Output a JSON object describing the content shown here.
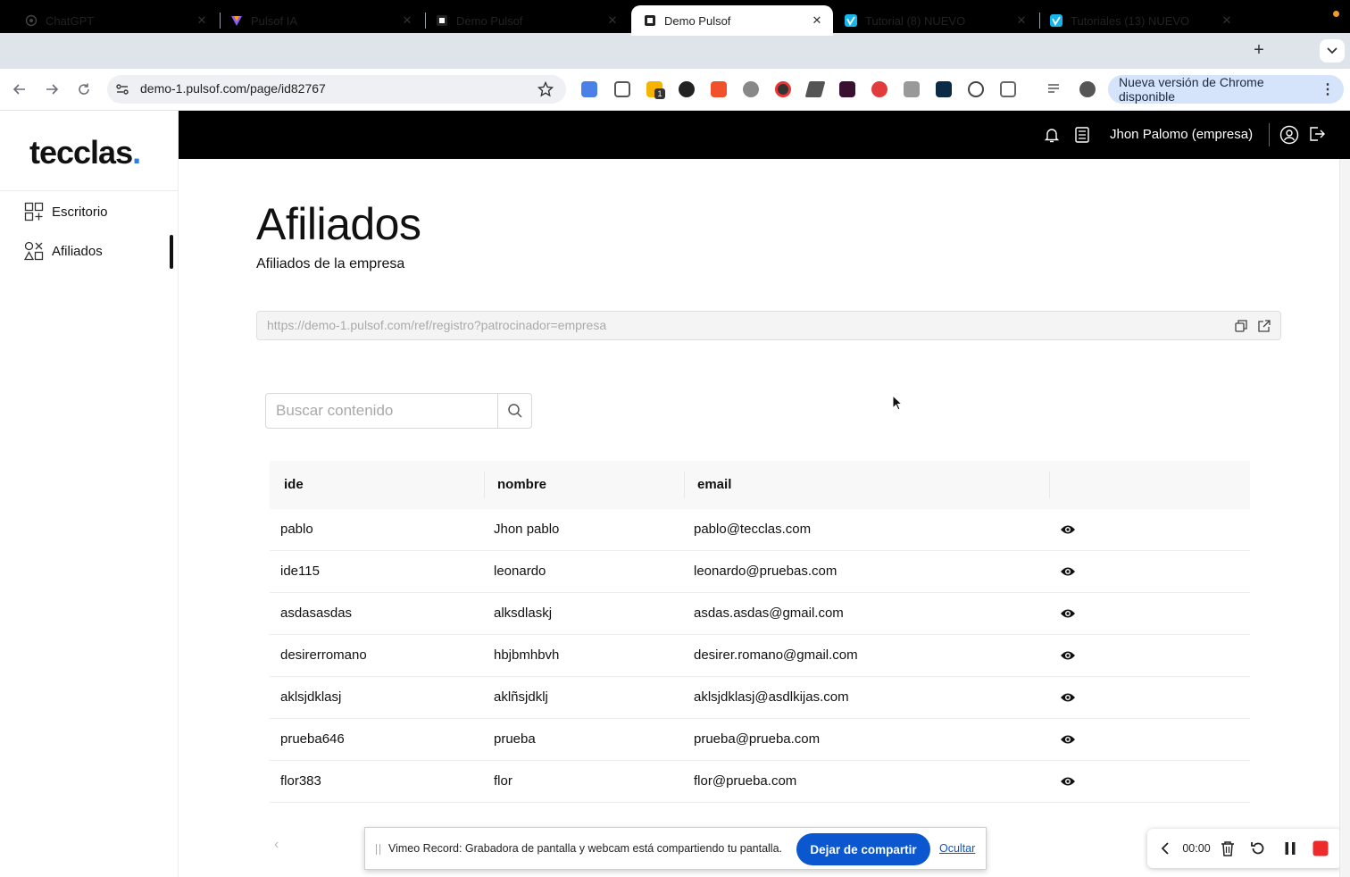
{
  "browser": {
    "tabs": [
      {
        "label": "ChatGPT",
        "icon": "chatgpt-icon",
        "active": false
      },
      {
        "label": "Pulsof IA",
        "icon": "pulsof-ia-icon",
        "active": false
      },
      {
        "label": "Demo Pulsof",
        "icon": "pulsof-icon",
        "active": false
      },
      {
        "label": "Demo Pulsof",
        "icon": "pulsof-icon",
        "active": true
      },
      {
        "label": "Tutorial (8) NUEVO",
        "icon": "vimeo-icon",
        "active": false
      },
      {
        "label": "Tutoriales (13) NUEVO",
        "icon": "vimeo-icon",
        "active": false
      }
    ],
    "new_tab": "+",
    "url": "demo-1.pulsof.com/page/id82767",
    "update_label": "Nueva versión de Chrome disponible",
    "extension_badge": "1"
  },
  "app": {
    "logo_text": "tecclas",
    "logo_dot": ".",
    "brand_color": "#2a7de1",
    "sidebar": [
      {
        "label": "Escritorio",
        "icon": "dashboard-grid-icon"
      },
      {
        "label": "Afiliados",
        "icon": "shapes-icon"
      }
    ],
    "user_name": "Jhon Palomo (empresa)"
  },
  "page": {
    "title": "Afiliados",
    "subtitle": "Afiliados de la empresa",
    "referral_url": "https://demo-1.pulsof.com/ref/registro?patrocinador=empresa",
    "search_placeholder": "Buscar contenido",
    "columns": [
      "ide",
      "nombre",
      "email"
    ],
    "rows": [
      {
        "ide": "pablo",
        "nombre": "Jhon pablo",
        "email": "pablo@tecclas.com"
      },
      {
        "ide": "ide115",
        "nombre": "leonardo",
        "email": "leonardo@pruebas.com"
      },
      {
        "ide": "asdasasdas",
        "nombre": "alksdlaskj",
        "email": "asdas.asdas@gmail.com"
      },
      {
        "ide": "desirerromano",
        "nombre": "hbjbmhbvh",
        "email": "desirer.romano@gmail.com"
      },
      {
        "ide": "aklsjdklasj",
        "nombre": "aklñsjdklj",
        "email": "aklsjdklasj@asdlkijas.com"
      },
      {
        "ide": "prueba646",
        "nombre": "prueba",
        "email": "prueba@prueba.com"
      },
      {
        "ide": "flor383",
        "nombre": "flor",
        "email": "flor@prueba.com"
      }
    ],
    "pager_prev": "‹"
  },
  "share_bar": {
    "message": "Vimeo Record: Grabadora de pantalla y webcam está compartiendo tu pantalla.",
    "stop_label": "Dejar de compartir",
    "hide_label": "Ocultar"
  },
  "recorder": {
    "time": "00:00"
  }
}
